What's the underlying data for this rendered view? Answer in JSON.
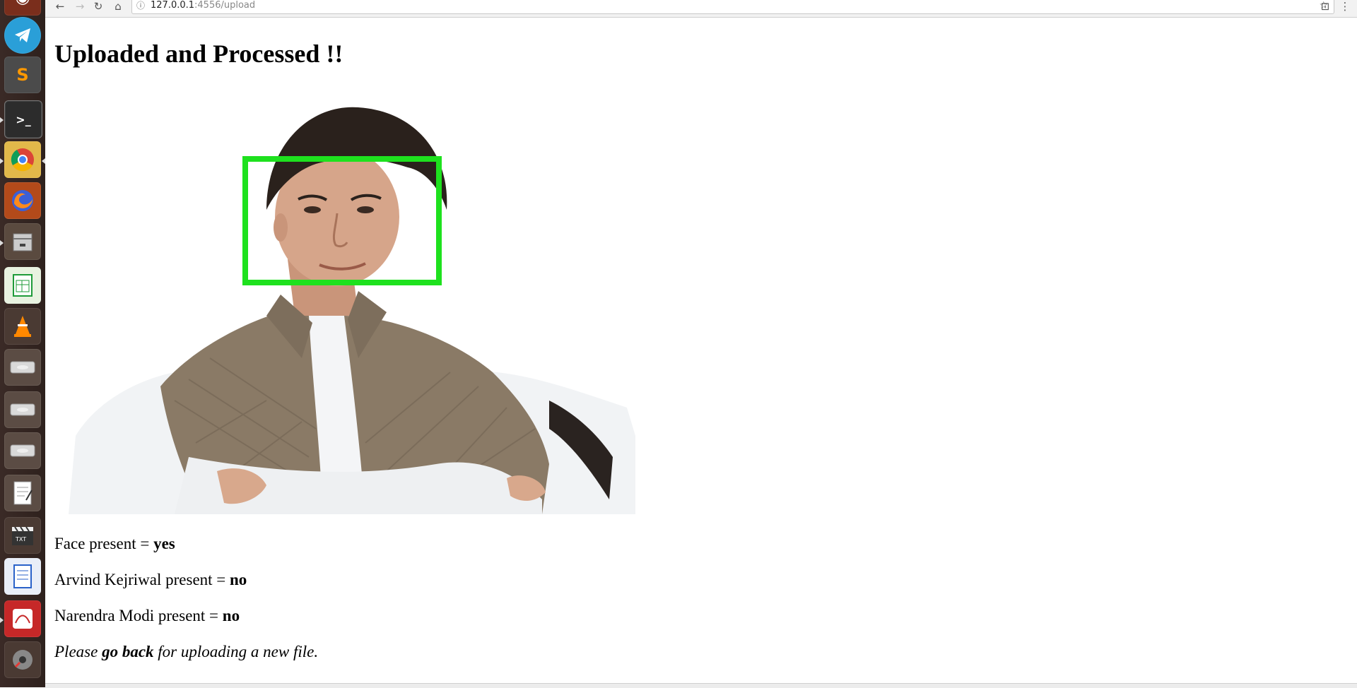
{
  "browser": {
    "url_host": "127.0.0.1",
    "url_path": ":4556/upload",
    "info_icon": "info-icon",
    "back_icon": "back-arrow-icon",
    "forward_icon": "forward-arrow-icon",
    "reload_icon": "reload-icon",
    "home_icon": "home-icon",
    "star_icon": "bookmark-star-icon",
    "menu_icon": "kebab-menu-icon"
  },
  "launcher": {
    "items": [
      {
        "name": "unknown-app",
        "icon": "app-icon"
      },
      {
        "name": "telegram",
        "icon": "telegram-icon"
      },
      {
        "name": "sublime-text",
        "icon": "sublime-text-icon"
      },
      {
        "name": "terminal",
        "icon": "terminal-icon"
      },
      {
        "name": "chrome",
        "icon": "chrome-icon"
      },
      {
        "name": "firefox",
        "icon": "firefox-icon"
      },
      {
        "name": "files",
        "icon": "file-cabinet-icon"
      },
      {
        "name": "libreoffice-calc",
        "icon": "spreadsheet-icon"
      },
      {
        "name": "vlc",
        "icon": "vlc-cone-icon"
      },
      {
        "name": "drive-1",
        "icon": "drive-icon"
      },
      {
        "name": "drive-2",
        "icon": "drive-icon"
      },
      {
        "name": "drive-3",
        "icon": "drive-icon"
      },
      {
        "name": "text-editor",
        "icon": "text-editor-icon"
      },
      {
        "name": "video-editor",
        "icon": "clapperboard-icon"
      },
      {
        "name": "libreoffice-writer",
        "icon": "document-icon"
      },
      {
        "name": "pdf-viewer",
        "icon": "pdf-icon"
      },
      {
        "name": "media-app",
        "icon": "media-icon"
      }
    ]
  },
  "page": {
    "title": "Uploaded and Processed !!",
    "image_alt_icon": "face-detection-photo",
    "face_label": "Face present = ",
    "face_value": "yes",
    "kejriwal_label": "Arvind Kejriwal present = ",
    "kejriwal_value": "no",
    "modi_label": "Narendra Modi present = ",
    "modi_value": "no",
    "note_prefix": "Please ",
    "note_link": "go back",
    "note_suffix": " for uploading a new file."
  },
  "colors": {
    "detection_box": "#1ee11e",
    "launcher_bg": "#2e211d",
    "vest": "#8a7a66",
    "shirt": "#f2f4f6",
    "hair": "#2a211c",
    "skin": "#d6a58a"
  }
}
